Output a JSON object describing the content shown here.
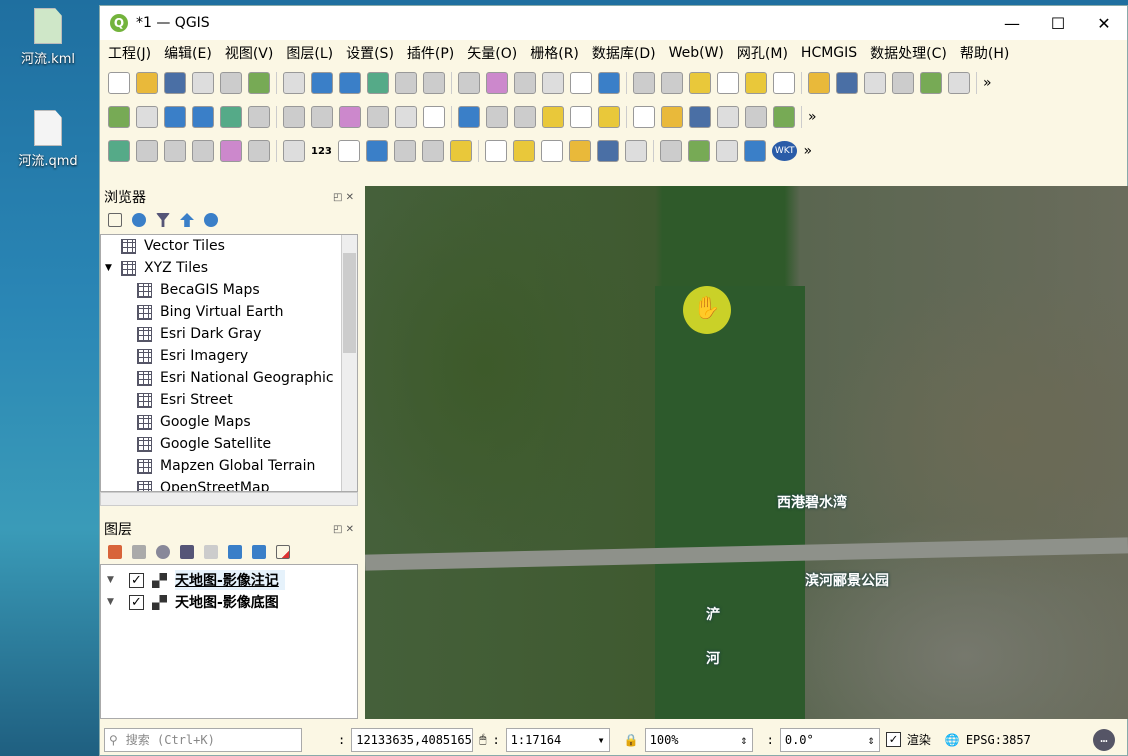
{
  "desktop": {
    "icons": [
      {
        "label": "河流.kml"
      },
      {
        "label": "河流.qmd"
      }
    ]
  },
  "window": {
    "title": "*1 — QGIS",
    "minimize": "—",
    "maximize": "☐",
    "close": "✕"
  },
  "menu": [
    "工程(J)",
    "编辑(E)",
    "视图(V)",
    "图层(L)",
    "设置(S)",
    "插件(P)",
    "矢量(O)",
    "栅格(R)",
    "数据库(D)",
    "Web(W)",
    "网孔(M)",
    "HCMGIS",
    "数据处理(C)",
    "帮助(H)"
  ],
  "toolbar": {
    "more": "»",
    "wkt": "WKT",
    "label_123": "123"
  },
  "browser": {
    "title": "浏览器",
    "items": [
      {
        "label": "Vector Tiles",
        "indent": 0,
        "expand": ""
      },
      {
        "label": "XYZ Tiles",
        "indent": 0,
        "expand": "▼"
      },
      {
        "label": "BecaGIS Maps",
        "indent": 1
      },
      {
        "label": "Bing Virtual Earth",
        "indent": 1
      },
      {
        "label": "Esri Dark Gray",
        "indent": 1
      },
      {
        "label": "Esri Imagery",
        "indent": 1
      },
      {
        "label": "Esri National Geographic",
        "indent": 1
      },
      {
        "label": "Esri Street",
        "indent": 1
      },
      {
        "label": "Google Maps",
        "indent": 1
      },
      {
        "label": "Google Satellite",
        "indent": 1
      },
      {
        "label": "Mapzen Global Terrain",
        "indent": 1
      },
      {
        "label": "OpenStreetMap",
        "indent": 1
      }
    ]
  },
  "layers": {
    "title": "图层",
    "items": [
      {
        "label": "天地图-影像注记",
        "checked": true,
        "selected": true
      },
      {
        "label": "天地图-影像底图",
        "checked": true,
        "selected": false
      }
    ]
  },
  "map": {
    "labels": [
      "西港碧水湾",
      "滨河郦景公园",
      "浐",
      "河"
    ]
  },
  "status": {
    "search_placeholder": "搜索 (Ctrl+K)",
    "coordinate": "12133635,4085165",
    "scale": "1:17164",
    "magnifier": "100%",
    "rotation": "0.0°",
    "render_label": "渲染",
    "render_checked": true,
    "crs": "EPSG:3857"
  }
}
